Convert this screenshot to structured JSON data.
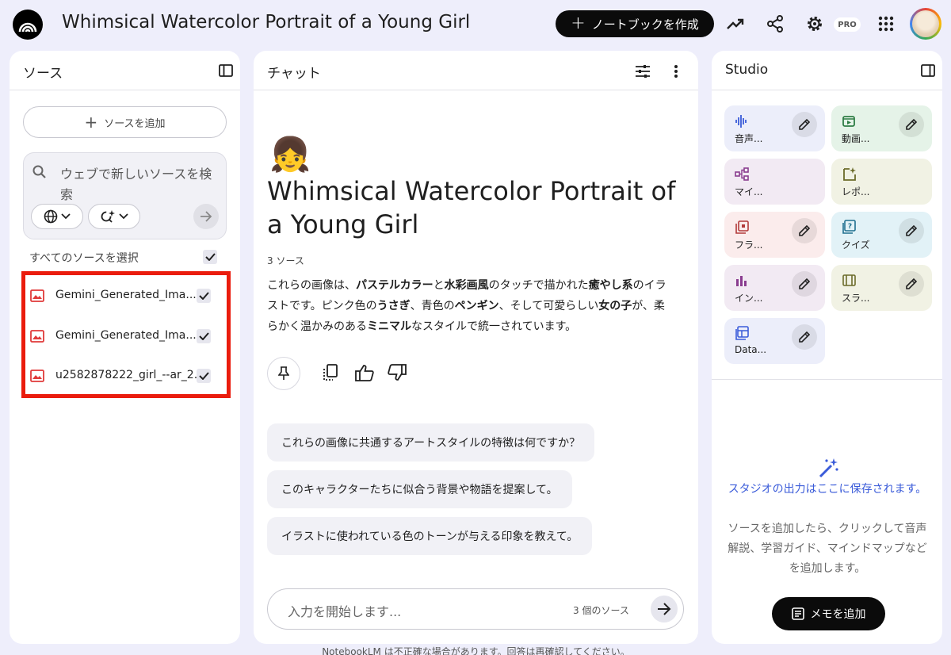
{
  "header": {
    "title": "Whimsical Watercolor Portrait of a Young Girl",
    "create_notebook": "ノートブックを作成",
    "pro_badge": "PRO"
  },
  "sources_panel": {
    "title": "ソース",
    "add_source": "ソースを追加",
    "search_placeholder": "ウェブで新しいソースを検索",
    "select_all": "すべてのソースを選択",
    "items": [
      {
        "name": "Gemini_Generated_Ima...",
        "checked": true
      },
      {
        "name": "Gemini_Generated_Ima...",
        "checked": true
      },
      {
        "name": "u2582878222_girl_--ar_2...",
        "checked": true
      }
    ]
  },
  "chat_panel": {
    "title": "チャット",
    "notebook_emoji": "👧",
    "notebook_title": "Whimsical Watercolor Portrait of a Young Girl",
    "source_count": "3 ソース",
    "summary_segments": [
      {
        "text": "これらの画像は、",
        "bold": false
      },
      {
        "text": "パステルカラー",
        "bold": true
      },
      {
        "text": "と",
        "bold": false
      },
      {
        "text": "水彩画風",
        "bold": true
      },
      {
        "text": "のタッチで描かれた",
        "bold": false
      },
      {
        "text": "癒やし系",
        "bold": true
      },
      {
        "text": "のイラストです。ピンク色の",
        "bold": false
      },
      {
        "text": "うさぎ",
        "bold": true
      },
      {
        "text": "、青色の",
        "bold": false
      },
      {
        "text": "ペンギン",
        "bold": true
      },
      {
        "text": "、そして可愛らしい",
        "bold": false
      },
      {
        "text": "女の子",
        "bold": true
      },
      {
        "text": "が、柔らかく温かみのある",
        "bold": false
      },
      {
        "text": "ミニマル",
        "bold": true
      },
      {
        "text": "なスタイルで統一されています。",
        "bold": false
      }
    ],
    "suggestions": [
      "これらの画像に共通するアートスタイルの特徴は何ですか？",
      "このキャラクターたちに似合う背景や物語を提案して。",
      "イラストに使われている色のトーンが与える印象を教えて。"
    ],
    "input_placeholder": "入力を開始します...",
    "input_source_count": "3 個のソース"
  },
  "studio_panel": {
    "title": "Studio",
    "tiles": [
      {
        "label": "音声...",
        "icon": "audio-waveform-icon",
        "bg": "#eceefa",
        "color": "#3a5bd9",
        "editable": true
      },
      {
        "label": "動画...",
        "icon": "video-icon",
        "bg": "#e5f3e8",
        "color": "#2f7d45",
        "editable": true
      },
      {
        "label": "マイ...",
        "icon": "mindmap-icon",
        "bg": "#f2eaf3",
        "color": "#8a3d8f",
        "editable": false
      },
      {
        "label": "レポ...",
        "icon": "report-icon",
        "bg": "#f1f2e4",
        "color": "#6b6b2a",
        "editable": false
      },
      {
        "label": "フラ...",
        "icon": "flashcard-icon",
        "bg": "#fbecec",
        "color": "#b23a3a",
        "editable": true
      },
      {
        "label": "クイズ",
        "icon": "quiz-icon",
        "bg": "#e2f2f7",
        "color": "#1f6f8f",
        "editable": true
      },
      {
        "label": "イン...",
        "icon": "infographic-icon",
        "bg": "#f2eaf3",
        "color": "#8a3d8f",
        "editable": true
      },
      {
        "label": "スラ...",
        "icon": "slides-icon",
        "bg": "#f1f2e4",
        "color": "#6b6b2a",
        "editable": true
      },
      {
        "label": "Data...",
        "icon": "datatable-icon",
        "bg": "#eceefa",
        "color": "#3a5bd9",
        "editable": true
      }
    ],
    "empty_title": "スタジオの出力はここに保存されます。",
    "empty_sub": "ソースを追加したら、クリックして音声解説、学習ガイド、マインドマップなどを追加します。",
    "add_memo": "メモを追加"
  },
  "footer": {
    "disclaimer": "NotebookLM は不正確な場合があります。回答は再確認してください。"
  },
  "colors": {
    "accent": "#3a5bd9",
    "highlight_box": "#ea1c0d",
    "background": "#eeeefb"
  }
}
